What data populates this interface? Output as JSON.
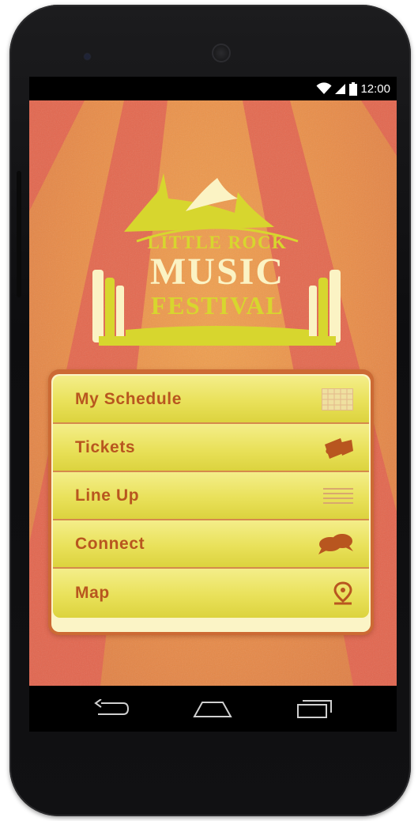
{
  "status_bar": {
    "time": "12:00",
    "icons": [
      "wifi-icon",
      "signal-icon",
      "battery-icon"
    ]
  },
  "logo": {
    "line1": "LITTLE ROCK",
    "line2": "MUSIC",
    "line3": "FESTIVAL"
  },
  "menu": {
    "items": [
      {
        "label": "My Schedule",
        "icon": "calendar-grid-icon"
      },
      {
        "label": "Tickets",
        "icon": "ticket-icon"
      },
      {
        "label": "Line Up",
        "icon": "list-lines-icon"
      },
      {
        "label": "Connect",
        "icon": "chat-bubbles-icon"
      },
      {
        "label": "Map",
        "icon": "map-pin-icon"
      }
    ]
  },
  "nav": {
    "buttons": [
      "back-icon",
      "home-icon",
      "recents-icon"
    ]
  },
  "colors": {
    "background": "#e8894a",
    "beam": "#e3604f",
    "menu_item": "#e9e15a",
    "menu_label": "#b8561f",
    "logo_yellow": "#d7d62e",
    "logo_cream": "#fbf3c4"
  }
}
